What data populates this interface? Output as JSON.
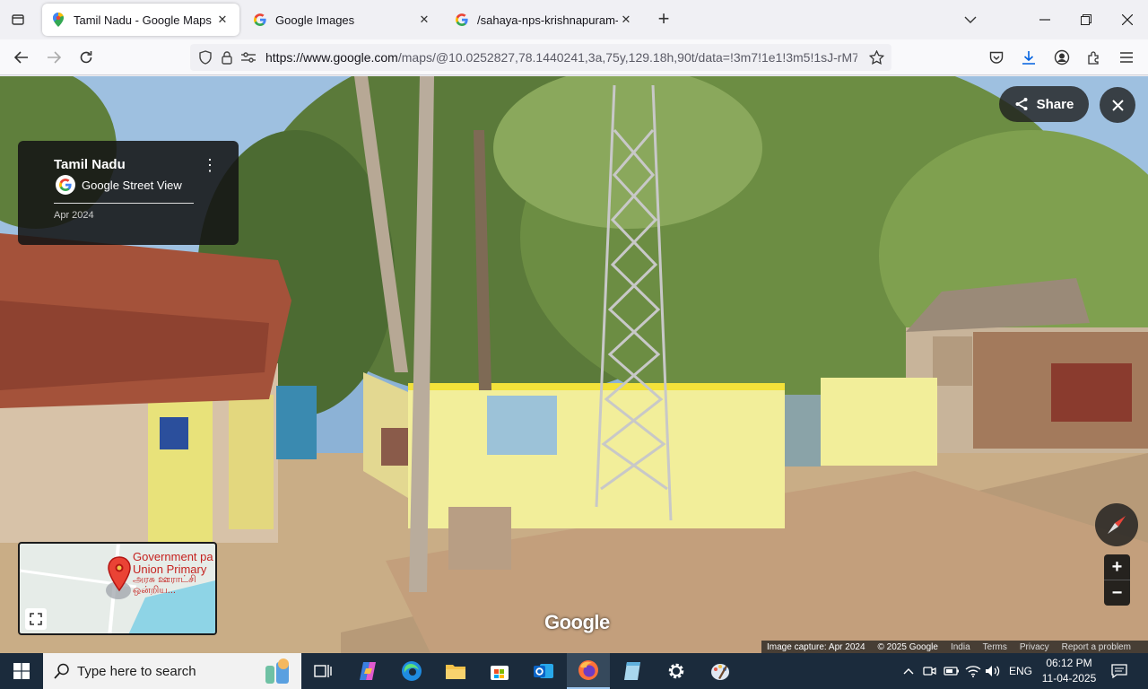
{
  "browser": {
    "tabs": [
      {
        "title": "Tamil Nadu - Google Maps",
        "favicon": "maps-pin-icon",
        "active": true
      },
      {
        "title": "Google Images",
        "favicon": "google-g-icon",
        "active": false
      },
      {
        "title": "/sahaya-nps-krishnapuram-colo",
        "favicon": "google-g-icon",
        "active": false
      }
    ],
    "url_host": "https://www.google.com",
    "url_path": "/maps/@10.0252827,78.1440241,3a,75y,129.18h,90t/data=!3m7!1e1!3m5!1sJ-rM7G"
  },
  "streetview": {
    "place": "Tamil Nadu",
    "provider": "Google Street View",
    "date": "Apr 2024",
    "share_label": "Share",
    "minimap": {
      "title_line1": "Government pa",
      "title_line2": "Union Primary",
      "subtitle_line1": "அரசு ஊராட்சி",
      "subtitle_line2": "ஒன்றிய..."
    },
    "watermark": "Google",
    "attribution": {
      "capture": "Image capture: Apr 2024",
      "copyright": "© 2025 Google",
      "country": "India",
      "terms": "Terms",
      "privacy": "Privacy",
      "report": "Report a problem"
    }
  },
  "taskbar": {
    "search_placeholder": "Type here to search",
    "language": "ENG",
    "time": "06:12 PM",
    "date": "11-04-2025"
  },
  "colors": {
    "wall_yellow": "#f2ee9a",
    "roof_tile": "#a4523a",
    "maps_red": "#c5221f",
    "taskbar": "#1b2b3c"
  }
}
